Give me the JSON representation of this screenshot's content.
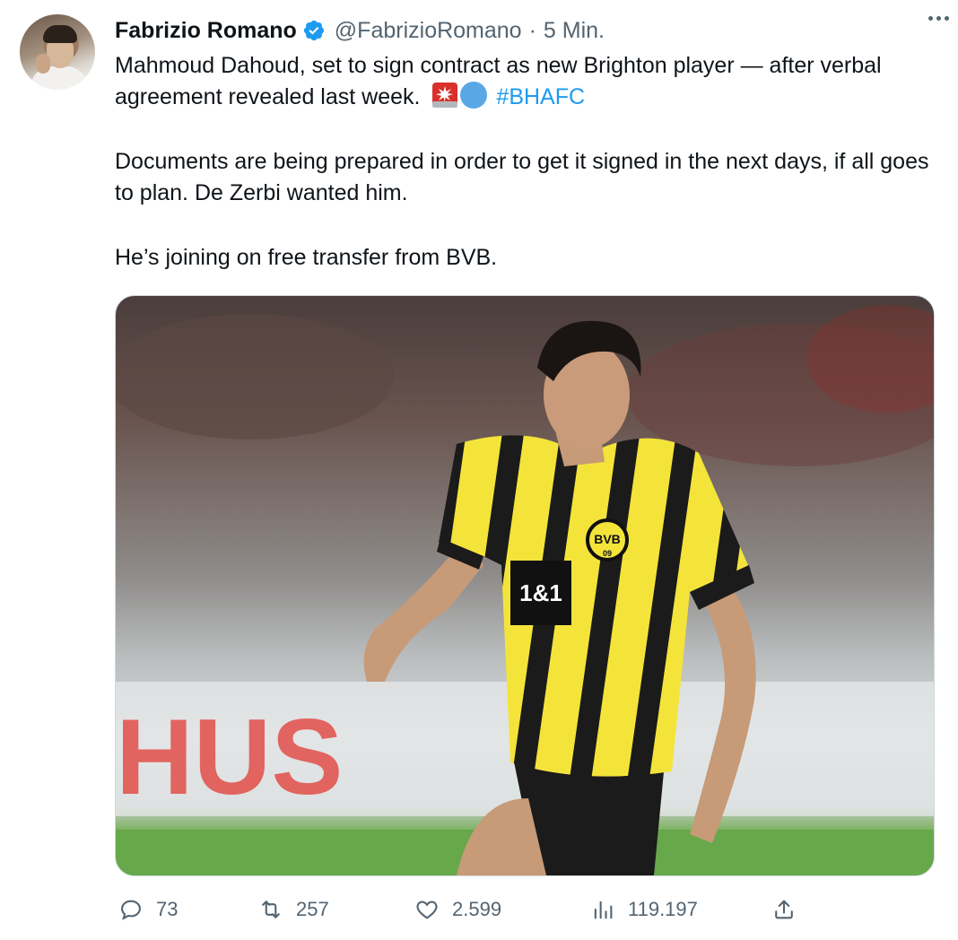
{
  "author": {
    "name": "Fabrizio Romano",
    "handle": "@FabrizioRomano",
    "separator": "·",
    "time": "5 Min."
  },
  "tweet": {
    "line1": "Mahmoud Dahoud, set to sign contract as new Brighton player — after verbal agreement revealed last week.",
    "hashtag": "#BHAFC",
    "paragraph2": "Documents are being prepared in order to get it signed in the next days, if all goes to plan. De Zerbi wanted him.",
    "paragraph3": "He’s joining on free transfer from BVB."
  },
  "media": {
    "shirt_sponsor": "1&1",
    "crest_text": "BVB",
    "crest_year": "09",
    "board_text": "HUS"
  },
  "actions": {
    "replies": "73",
    "retweets": "257",
    "likes": "2.599",
    "views": "119.197"
  },
  "icons": [
    "verified-badge-icon",
    "more-icon",
    "siren-emoji-icon",
    "blue-circle-emoji-icon",
    "reply-icon",
    "retweet-icon",
    "like-icon",
    "views-icon",
    "share-icon"
  ],
  "colors": {
    "link": "#1d9bf0",
    "secondary": "#536471",
    "verified": "#1d9bf0",
    "jersey_yellow": "#f4e43a"
  }
}
